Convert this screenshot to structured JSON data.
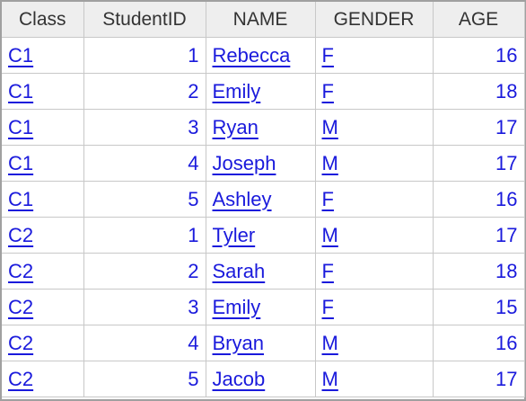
{
  "table": {
    "headers": [
      "Class",
      "StudentID",
      "NAME",
      "GENDER",
      "AGE"
    ],
    "rows": [
      {
        "class": "C1",
        "student_id": "1",
        "name": "Rebecca",
        "gender": "F",
        "age": "16"
      },
      {
        "class": "C1",
        "student_id": "2",
        "name": "Emily",
        "gender": "F",
        "age": "18"
      },
      {
        "class": "C1",
        "student_id": "3",
        "name": "Ryan",
        "gender": "M",
        "age": "17"
      },
      {
        "class": "C1",
        "student_id": "4",
        "name": "Joseph",
        "gender": "M",
        "age": "17"
      },
      {
        "class": "C1",
        "student_id": "5",
        "name": "Ashley",
        "gender": "F",
        "age": "16"
      },
      {
        "class": "C2",
        "student_id": "1",
        "name": "Tyler",
        "gender": "M",
        "age": "17"
      },
      {
        "class": "C2",
        "student_id": "2",
        "name": "Sarah",
        "gender": "F",
        "age": "18"
      },
      {
        "class": "C2",
        "student_id": "3",
        "name": "Emily",
        "gender": "F",
        "age": "15"
      },
      {
        "class": "C2",
        "student_id": "4",
        "name": "Bryan",
        "gender": "M",
        "age": "16"
      },
      {
        "class": "C2",
        "student_id": "5",
        "name": "Jacob",
        "gender": "M",
        "age": "17"
      }
    ]
  },
  "colors": {
    "header_bg": "#eeeeee",
    "header_text": "#333333",
    "cell_text": "#1a1adc",
    "grid_line": "#c8c8c8"
  }
}
